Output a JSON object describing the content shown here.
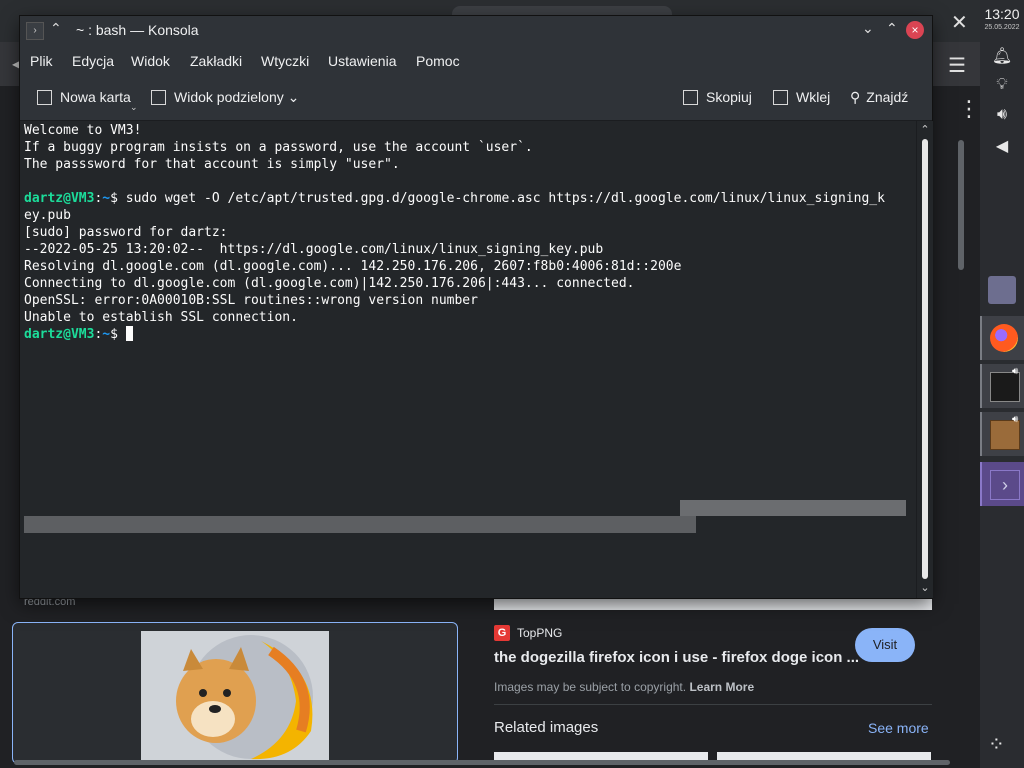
{
  "window": {
    "title": "~ : bash — Konsola",
    "close_glyph": "×"
  },
  "menu": [
    "Plik",
    "Edycja",
    "Widok",
    "Zakładki",
    "Wtyczki",
    "Ustawienia",
    "Pomoc"
  ],
  "toolbar": {
    "new_tab": "Nowa karta",
    "split_view": "Widok podzielony",
    "copy": "Skopiuj",
    "paste": "Wklej",
    "find": "Znajdź"
  },
  "terminal": {
    "lines": [
      "Welcome to VM3!",
      "If a buggy program insists on a password, use the account `user`.",
      "The passsword for that account is simply \"user\".",
      "",
      "",
      "ey.pub",
      "[sudo] password for dartz:",
      "--2022-05-25 13:20:02--  https://dl.google.com/linux/linux_signing_key.pub",
      "Resolving dl.google.com (dl.google.com)... 142.250.176.206, 2607:f8b0:4006:81d::200e",
      "Connecting to dl.google.com (dl.google.com)|142.250.176.206|:443... connected.",
      "OpenSSL: error:0A00010B:SSL routines::wrong version number",
      "Unable to establish SSL connection."
    ],
    "prompt_user": "dartz@VM3",
    "prompt_path": "~",
    "prompt_sign": "$",
    "command": " sudo wget -O /etc/apt/trusted.gpg.d/google-chrome.asc https://dl.google.com/linux/linux_signing_k"
  },
  "browser": {
    "reddit": "reddit.com",
    "source_badge": "G",
    "source_name": "TopPNG",
    "result_title": "the dogezilla firefox icon i use - firefox doge icon ...",
    "copyright": "Images may be subject to copyright.",
    "learn_more": "Learn More",
    "visit": "Visit",
    "related": "Related images",
    "see_more": "See more"
  },
  "panel": {
    "time": "13:20",
    "date": "25.05.2022"
  }
}
